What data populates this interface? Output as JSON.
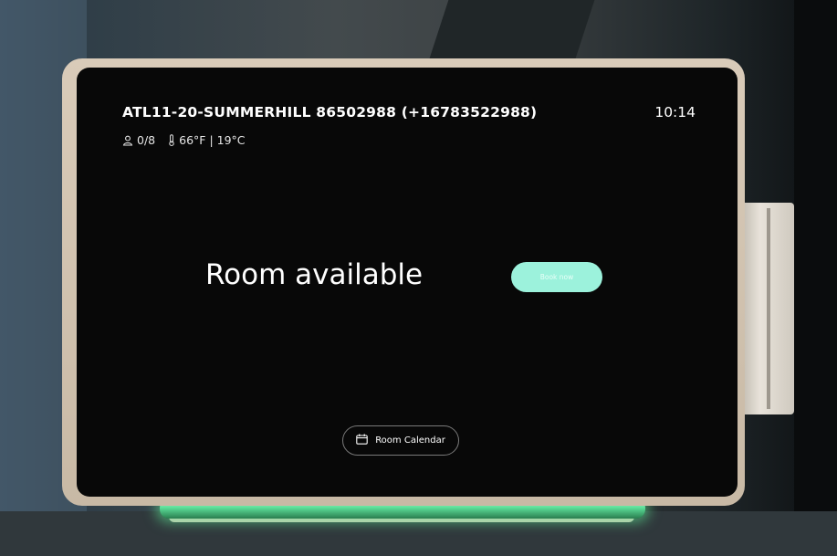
{
  "device": {
    "room_name": "ATL11-20-SUMMERHILL 86502988 (+16783522988)",
    "time": "10:14",
    "occupancy": "0/8",
    "temperature": "66°F | 19°C",
    "room_status": "Room available",
    "book_button_label": "Book now",
    "calendar_button_label": "Room Calendar",
    "icons": {
      "occupancy": "person-icon",
      "temperature": "thermometer-icon",
      "calendar": "calendar-icon"
    },
    "colors": {
      "screen": "#080808",
      "accent": "#9cf2dc",
      "text": "#ffffff",
      "led": "#5de09a"
    }
  }
}
